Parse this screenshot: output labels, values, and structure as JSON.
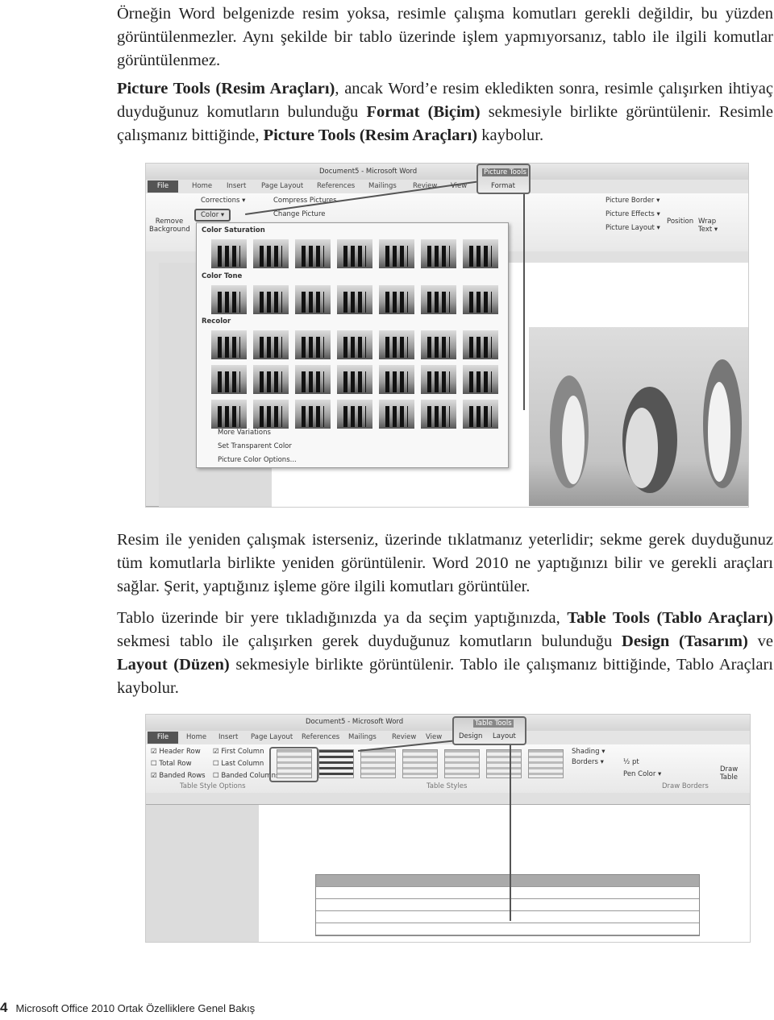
{
  "paragraphs": [
    [
      {
        "t": "Örneğin Word belgenizde resim yoksa, resimle çalışma komutları gerekli değildir, bu yüzden görüntülenmezler. Aynı şekilde bir tablo üzerinde işlem yapmıyorsanız, tablo ile ilgili komutlar görüntülenmez."
      }
    ],
    [
      {
        "t": "Picture Tools (Resim Araçları)",
        "b": true
      },
      {
        "t": ", ancak Word’e resim ekledikten sonra, resimle çalışırken ihtiyaç duyduğunuz komutların bulunduğu "
      },
      {
        "t": "Format (Biçim)",
        "b": true
      },
      {
        "t": " sekmesiyle birlikte görüntülenir. Resimle çalışmanız bittiğinde, "
      },
      {
        "t": "Picture Tools (Resim Araçları)",
        "b": true
      },
      {
        "t": " kaybolur."
      }
    ],
    [
      {
        "t": "Resim ile yeniden çalışmak isterseniz, üzerinde tıklatmanız yeterlidir; sekme gerek duyduğunuz tüm komutlarla birlikte yeniden görüntülenir. Word 2010 ne yaptığınızı bilir ve gerekli araçları sağlar. Şerit, yaptığınız işleme göre ilgili komutları görüntüler."
      }
    ],
    [
      {
        "t": "Tablo üzerinde bir yere tıkladığınızda ya da seçim yaptığınızda, "
      },
      {
        "t": "Table Tools (Tablo Araçları)",
        "b": true
      },
      {
        "t": " sekmesi tablo ile çalışırken gerek duyduğunuz komutların bulunduğu "
      },
      {
        "t": "Design (Tasarım)",
        "b": true
      },
      {
        "t": " ve "
      },
      {
        "t": "Layout (Düzen)",
        "b": true
      },
      {
        "t": " sekmesiyle birlikte görüntülenir. Tablo ile çalışmanız bittiğinde, Tablo Araçları kaybolur."
      }
    ]
  ],
  "shot1": {
    "title": "Document5 - Microsoft Word",
    "context_tab": "Picture Tools",
    "tabs": [
      "File",
      "Home",
      "Insert",
      "Page Layout",
      "References",
      "Mailings",
      "Review",
      "View",
      "Format"
    ],
    "buttons": {
      "remove_bg": "Remove Background",
      "corrections": "Corrections ▾",
      "color": "Color ▾",
      "compress": "Compress Pictures",
      "change": "Change Picture",
      "border": "Picture Border ▾",
      "effects": "Picture Effects ▾",
      "layout": "Picture Layout ▾",
      "position": "Position",
      "wrap": "Wrap Text ▾"
    },
    "sections": [
      "Color Saturation",
      "Color Tone",
      "Recolor"
    ],
    "menu": [
      "More Variations",
      "Set Transparent Color",
      "Picture Color Options..."
    ]
  },
  "shot2": {
    "title": "Document5 - Microsoft Word",
    "context_tab": "Table Tools",
    "tabs": [
      "File",
      "Home",
      "Insert",
      "Page Layout",
      "References",
      "Mailings",
      "Review",
      "View",
      "Design",
      "Layout"
    ],
    "options": [
      {
        "label": "Header Row",
        "checked": true
      },
      {
        "label": "First Column",
        "checked": true
      },
      {
        "label": "Total Row",
        "checked": false
      },
      {
        "label": "Last Column",
        "checked": false
      },
      {
        "label": "Banded Rows",
        "checked": true
      },
      {
        "label": "Banded Columns",
        "checked": false
      }
    ],
    "groups": [
      "Table Style Options",
      "Table Styles",
      "Draw Borders"
    ],
    "shading": "Shading ▾",
    "borders": "Borders ▾",
    "pen_weight": "½ pt",
    "pen_color": "Pen Color ▾",
    "draw_table": "Draw Table"
  },
  "footer": {
    "page": "4",
    "title": "Microsoft Office 2010 Ortak Özelliklere Genel Bakış"
  }
}
